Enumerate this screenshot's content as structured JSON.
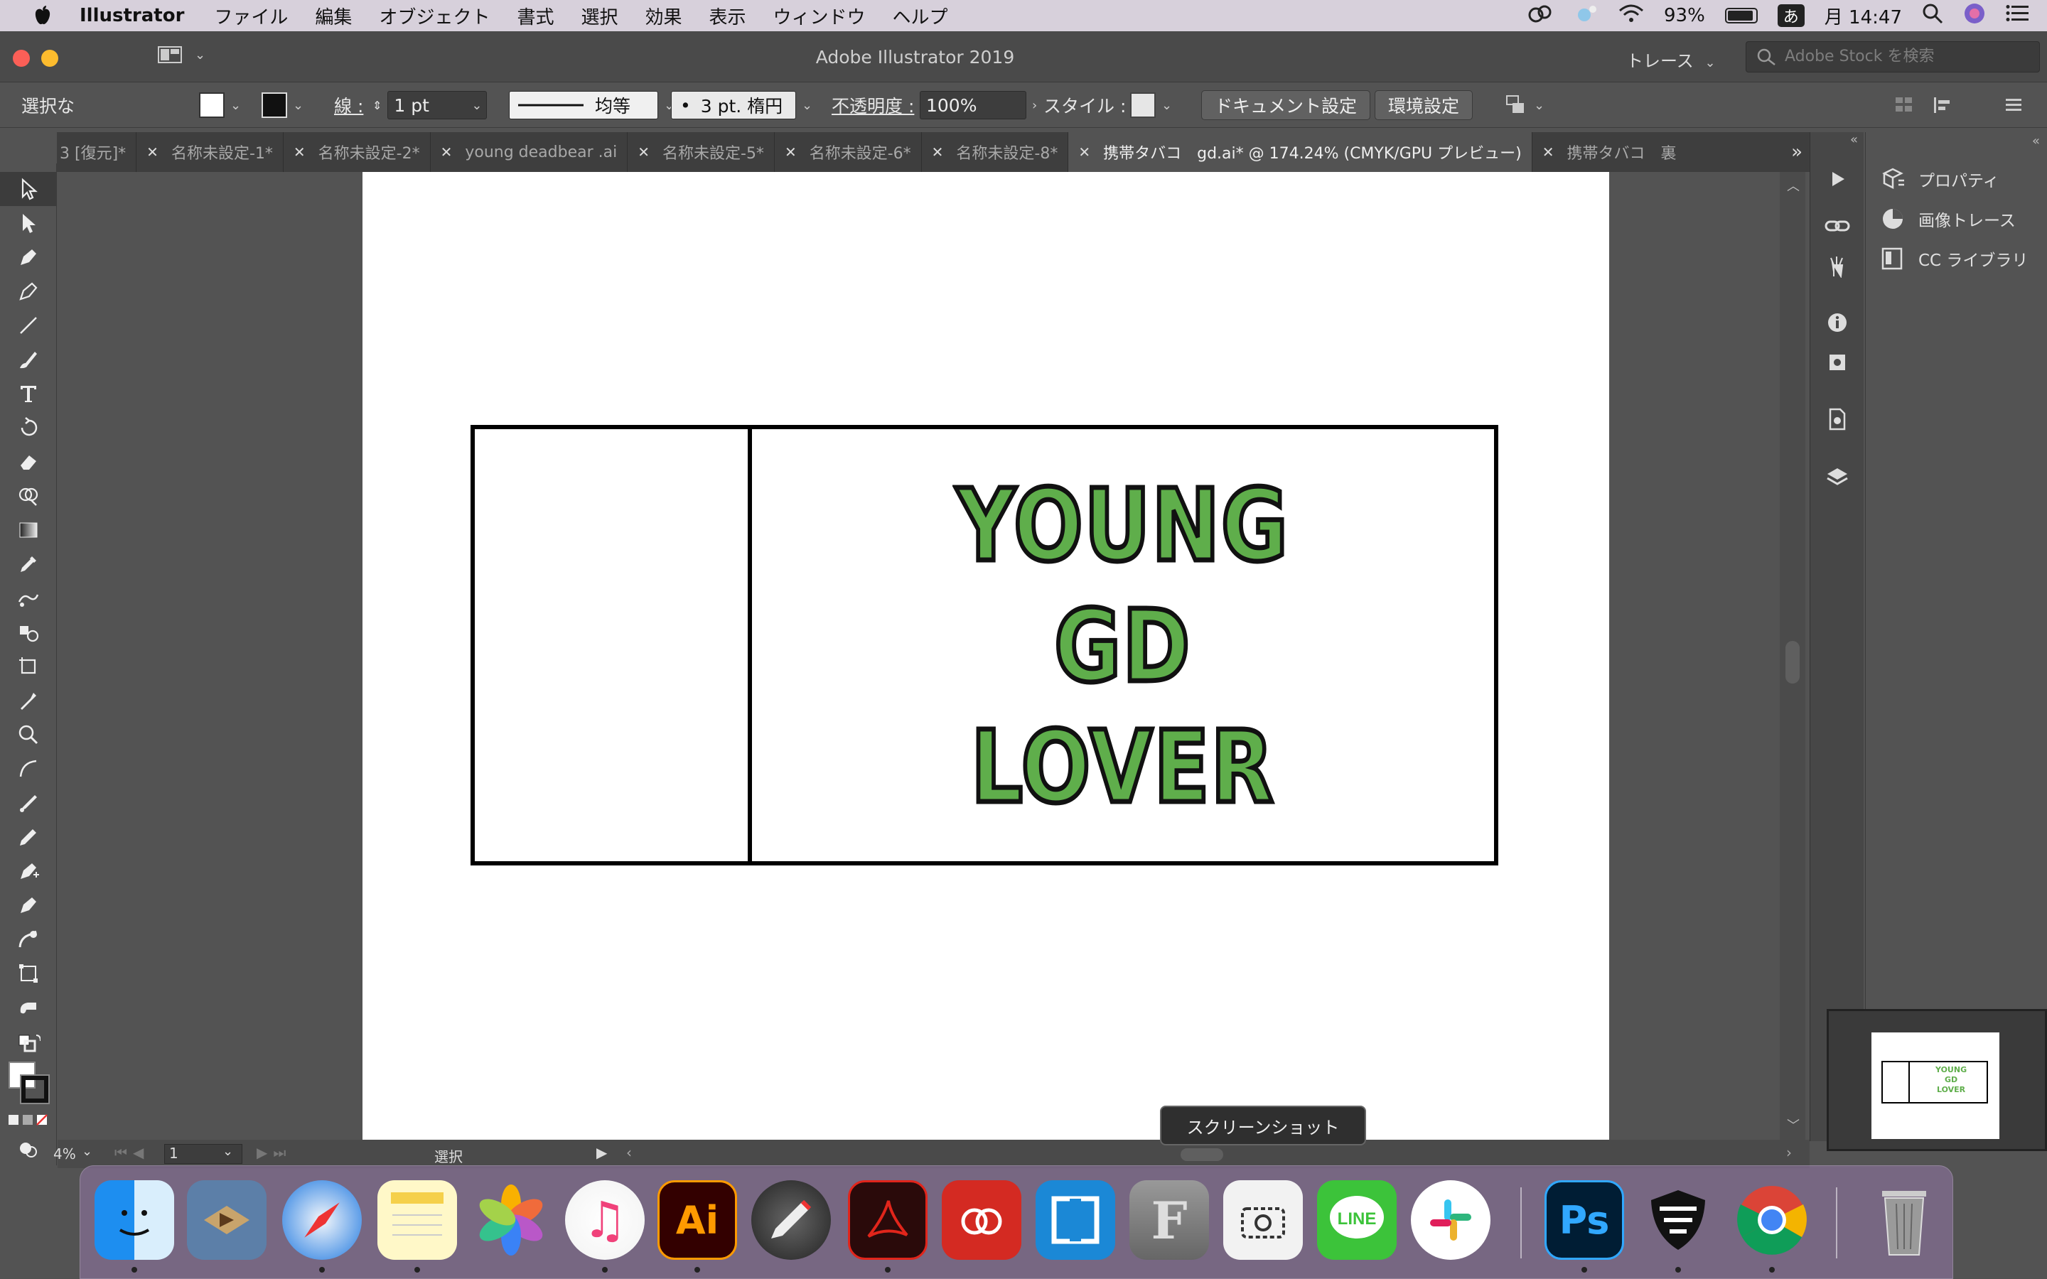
{
  "menubar": {
    "app_name": "Illustrator",
    "items": [
      "ファイル",
      "編集",
      "オブジェクト",
      "書式",
      "選択",
      "効果",
      "表示",
      "ウィンドウ",
      "ヘルプ"
    ],
    "battery": "93%",
    "input_method": "あ",
    "clock": "月 14:47"
  },
  "window": {
    "title": "Adobe Illustrator 2019",
    "workspace": "トレース",
    "stock_search_placeholder": "Adobe Stock を検索"
  },
  "controlbar": {
    "selection_label": "選択な",
    "stroke_label": "線 :",
    "stroke_weight": "1 pt",
    "stroke_profile": "均等",
    "brush": "3 pt. 楕円",
    "opacity_label": "不透明度 :",
    "opacity_value": "100%",
    "style_label": "スタイル :",
    "doc_settings": "ドキュメント設定",
    "preferences": "環境設定"
  },
  "tabs": [
    {
      "label": "3 [復元]*",
      "active": false
    },
    {
      "label": "名称未設定-1*",
      "active": false
    },
    {
      "label": "名称未設定-2*",
      "active": false
    },
    {
      "label": "young deadbear .ai",
      "active": false
    },
    {
      "label": "名称未設定-5*",
      "active": false
    },
    {
      "label": "名称未設定-6*",
      "active": false
    },
    {
      "label": "名称未設定-8*",
      "active": false
    },
    {
      "label": "携帯タバコ　gd.ai* @ 174.24% (CMYK/GPU プレビュー)",
      "active": true
    },
    {
      "label": "携帯タバコ　裏",
      "active": false
    }
  ],
  "artwork": {
    "lines": [
      "YOUNG",
      "GD",
      "LOVER"
    ],
    "text_color": "#5fae4b"
  },
  "panel": {
    "items": [
      "プロパティ",
      "画像トレース",
      "CC ライブラリ"
    ]
  },
  "statusbar": {
    "zoom": "4%",
    "page": "1",
    "mode": "選択"
  },
  "tooltip": "スクリーンショット",
  "dock_apps": [
    "Finder",
    "Mail",
    "Safari",
    "Notes",
    "Photos",
    "iTunes",
    "Illustrator",
    "Digital Color Meter",
    "Acrobat",
    "Creative Cloud",
    "Screenium",
    "Font Book",
    "Screenshot",
    "LINE",
    "Slack",
    "Photoshop",
    "Vivaldi",
    "Chrome",
    "Trash"
  ]
}
